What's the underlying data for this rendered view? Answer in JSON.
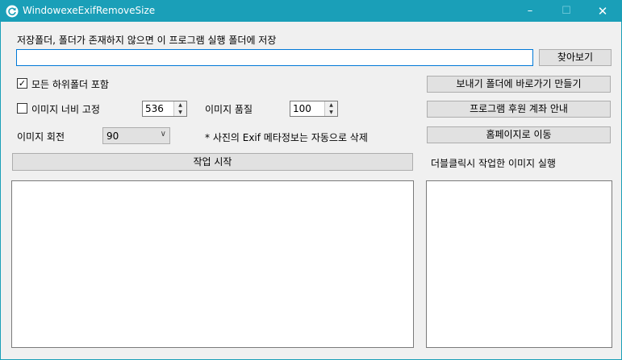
{
  "window": {
    "title": "WindowexeExifRemoveSize"
  },
  "save": {
    "label": "저장폴더, 폴더가 존재하지 않으면 이 프로그램 실행 폴더에 저장",
    "path_value": "",
    "browse_label": "찾아보기"
  },
  "options": {
    "all_subfolders": {
      "label": "모든 하위폴더 포함",
      "checked": true,
      "mark": "✓"
    },
    "fixed_width": {
      "label": "이미지 너비 고정",
      "checked": false,
      "value": "536"
    },
    "quality": {
      "label": "이미지 품질",
      "value": "100"
    },
    "rotation": {
      "label": "이미지 회전",
      "value": "90"
    },
    "exif_note": "* 사진의 Exif 메타정보는 자동으로 삭제"
  },
  "buttons": {
    "shortcut": "보내기 폴더에 바로가기 만들기",
    "donation": "프로그램 후원 계좌 안내",
    "homepage": "홈페이지로 이동",
    "start": "작업 시작"
  },
  "result_hint": "더블클릭시 작업한 이미지 실행",
  "icons": {
    "app": "refresh-icon",
    "minimize": "minimize-icon",
    "maximize": "maximize-icon",
    "close": "close-icon",
    "spin_up": "arrow-up-icon",
    "spin_down": "arrow-down-icon",
    "dropdown": "chevron-down-icon"
  },
  "colors": {
    "titlebar": "#1a9fb8",
    "accent_border": "#0078d7"
  }
}
